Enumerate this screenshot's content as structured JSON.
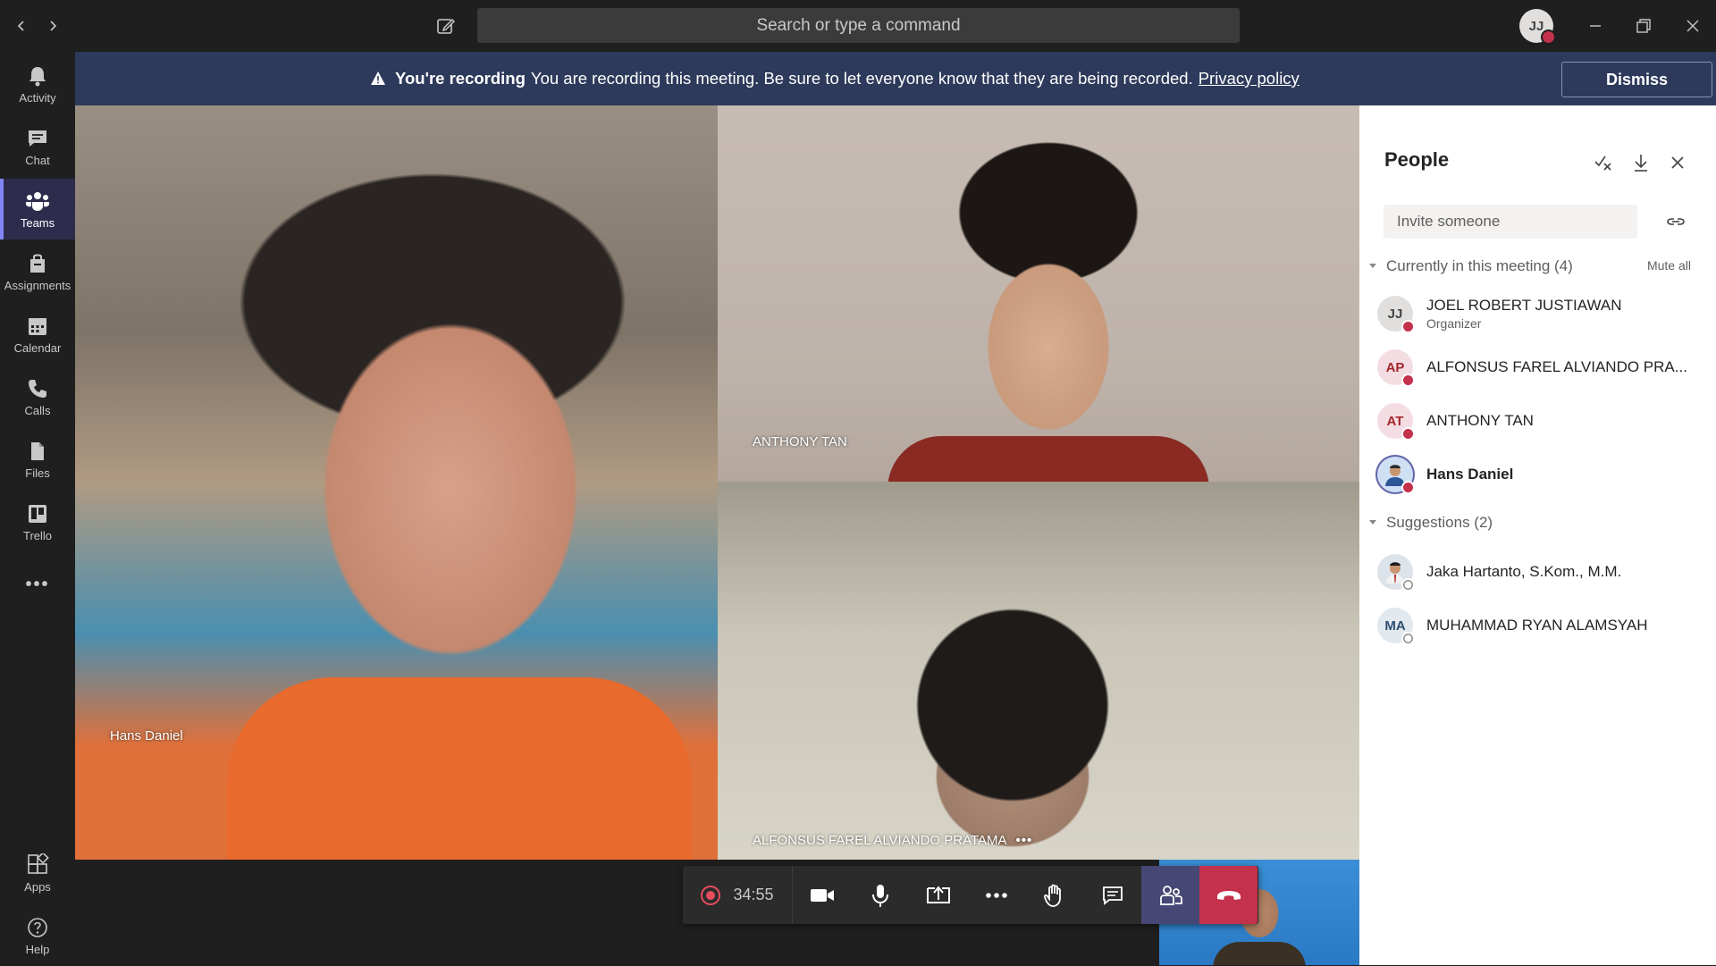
{
  "titlebar": {
    "search_placeholder": "Search or type a command",
    "user_initials": "JJ"
  },
  "rail": {
    "items": [
      {
        "label": "Activity",
        "icon": "bell-icon"
      },
      {
        "label": "Chat",
        "icon": "chat-icon"
      },
      {
        "label": "Teams",
        "icon": "teams-icon",
        "active": true
      },
      {
        "label": "Assignments",
        "icon": "assignments-icon"
      },
      {
        "label": "Calendar",
        "icon": "calendar-icon"
      },
      {
        "label": "Calls",
        "icon": "phone-icon"
      },
      {
        "label": "Files",
        "icon": "files-icon"
      },
      {
        "label": "Trello",
        "icon": "trello-icon"
      }
    ],
    "more": "•••",
    "apps_label": "Apps",
    "help_label": "Help"
  },
  "banner": {
    "title": "You're recording",
    "message": "You are recording this meeting. Be sure to let everyone know that they are being recorded.",
    "link": "Privacy policy",
    "dismiss": "Dismiss"
  },
  "video": {
    "tiles": [
      {
        "name": "Hans Daniel"
      },
      {
        "name": "ANTHONY TAN"
      },
      {
        "name": "ALFONSUS FAREL ALVIANDO PRATAMA",
        "more": "•••"
      }
    ]
  },
  "controls": {
    "timer": "34:55"
  },
  "people_panel": {
    "title": "People",
    "invite_placeholder": "Invite someone",
    "current_section": "Currently in this meeting (4)",
    "mute_all": "Mute all",
    "participants": [
      {
        "initials": "JJ",
        "name": "JOEL ROBERT JUSTIAWAN",
        "role": "Organizer",
        "avatar_bg": "#e1dfdd",
        "avatar_fg": "#444444"
      },
      {
        "initials": "AP",
        "name": "ALFONSUS FAREL ALVIANDO PRA...",
        "avatar_bg": "#f4dde2",
        "avatar_fg": "#a4262c"
      },
      {
        "initials": "AT",
        "name": "ANTHONY TAN",
        "avatar_bg": "#f4dde2",
        "avatar_fg": "#a4262c"
      },
      {
        "initials": "",
        "name": "Hans Daniel",
        "avatar_bg": "#cfe0f5",
        "avatar_fg": "#2b5797"
      }
    ],
    "suggestions_section": "Suggestions (2)",
    "suggestions": [
      {
        "initials": "",
        "name": "Jaka Hartanto, S.Kom., M.M.",
        "avatar_bg": "#dde3ea",
        "avatar_fg": "#333333"
      },
      {
        "initials": "MA",
        "name": "MUHAMMAD RYAN ALAMSYAH",
        "avatar_bg": "#e1e8ee",
        "avatar_fg": "#2f4f6f"
      }
    ]
  },
  "colors": {
    "accent": "#7f85f5",
    "banner_bg": "#2d3a5b",
    "hangup": "#c4314b",
    "recording": "#e84c5f"
  }
}
